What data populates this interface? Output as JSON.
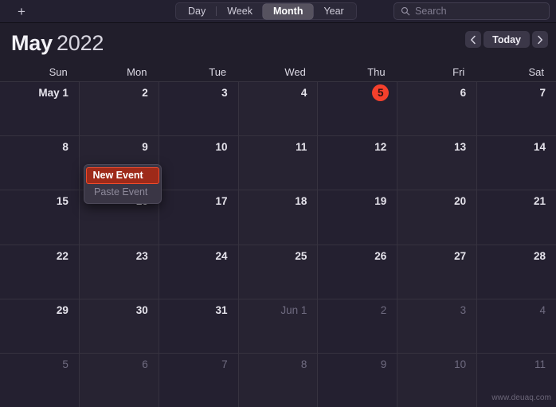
{
  "toolbar": {
    "add_label": "+",
    "add_icon": "plus-icon",
    "views": [
      {
        "label": "Day",
        "selected": false
      },
      {
        "label": "Week",
        "selected": false
      },
      {
        "label": "Month",
        "selected": true
      },
      {
        "label": "Year",
        "selected": false
      }
    ],
    "search": {
      "placeholder": "Search",
      "value": "",
      "icon": "search-icon"
    }
  },
  "header": {
    "month": "May",
    "year": "2022",
    "nav": {
      "prev_icon": "chevron-left-icon",
      "today_label": "Today",
      "next_icon": "chevron-right-icon"
    }
  },
  "weekdays": [
    "Sun",
    "Mon",
    "Tue",
    "Wed",
    "Thu",
    "Fri",
    "Sat"
  ],
  "weeks": [
    [
      {
        "label": "May 1",
        "other": false,
        "today": false
      },
      {
        "label": "2",
        "other": false,
        "today": false
      },
      {
        "label": "3",
        "other": false,
        "today": false
      },
      {
        "label": "4",
        "other": false,
        "today": false
      },
      {
        "label": "5",
        "other": false,
        "today": true
      },
      {
        "label": "6",
        "other": false,
        "today": false
      },
      {
        "label": "7",
        "other": false,
        "today": false
      }
    ],
    [
      {
        "label": "8",
        "other": false,
        "today": false
      },
      {
        "label": "9",
        "other": false,
        "today": false
      },
      {
        "label": "10",
        "other": false,
        "today": false
      },
      {
        "label": "11",
        "other": false,
        "today": false
      },
      {
        "label": "12",
        "other": false,
        "today": false
      },
      {
        "label": "13",
        "other": false,
        "today": false
      },
      {
        "label": "14",
        "other": false,
        "today": false
      }
    ],
    [
      {
        "label": "15",
        "other": false,
        "today": false
      },
      {
        "label": "16",
        "other": false,
        "today": false
      },
      {
        "label": "17",
        "other": false,
        "today": false
      },
      {
        "label": "18",
        "other": false,
        "today": false
      },
      {
        "label": "19",
        "other": false,
        "today": false
      },
      {
        "label": "20",
        "other": false,
        "today": false
      },
      {
        "label": "21",
        "other": false,
        "today": false
      }
    ],
    [
      {
        "label": "22",
        "other": false,
        "today": false
      },
      {
        "label": "23",
        "other": false,
        "today": false
      },
      {
        "label": "24",
        "other": false,
        "today": false
      },
      {
        "label": "25",
        "other": false,
        "today": false
      },
      {
        "label": "26",
        "other": false,
        "today": false
      },
      {
        "label": "27",
        "other": false,
        "today": false
      },
      {
        "label": "28",
        "other": false,
        "today": false
      }
    ],
    [
      {
        "label": "29",
        "other": false,
        "today": false
      },
      {
        "label": "30",
        "other": false,
        "today": false
      },
      {
        "label": "31",
        "other": false,
        "today": false
      },
      {
        "label": "Jun 1",
        "other": true,
        "today": false
      },
      {
        "label": "2",
        "other": true,
        "today": false
      },
      {
        "label": "3",
        "other": true,
        "today": false
      },
      {
        "label": "4",
        "other": true,
        "today": false
      }
    ],
    [
      {
        "label": "5",
        "other": true,
        "today": false
      },
      {
        "label": "6",
        "other": true,
        "today": false
      },
      {
        "label": "7",
        "other": true,
        "today": false
      },
      {
        "label": "8",
        "other": true,
        "today": false
      },
      {
        "label": "9",
        "other": true,
        "today": false
      },
      {
        "label": "10",
        "other": true,
        "today": false
      },
      {
        "label": "11",
        "other": true,
        "today": false
      }
    ]
  ],
  "context_menu": {
    "items": [
      {
        "label": "New Event",
        "state": "highlighted"
      },
      {
        "label": "Paste Event",
        "state": "disabled"
      }
    ]
  },
  "watermark": "www.deuaq.com",
  "colors": {
    "today_badge": "#f5402c",
    "menu_highlight_bg": "#9e2a19",
    "menu_highlight_border": "#f04a2b",
    "window_bg": "#211e2b",
    "cell_bg": "#272332"
  }
}
